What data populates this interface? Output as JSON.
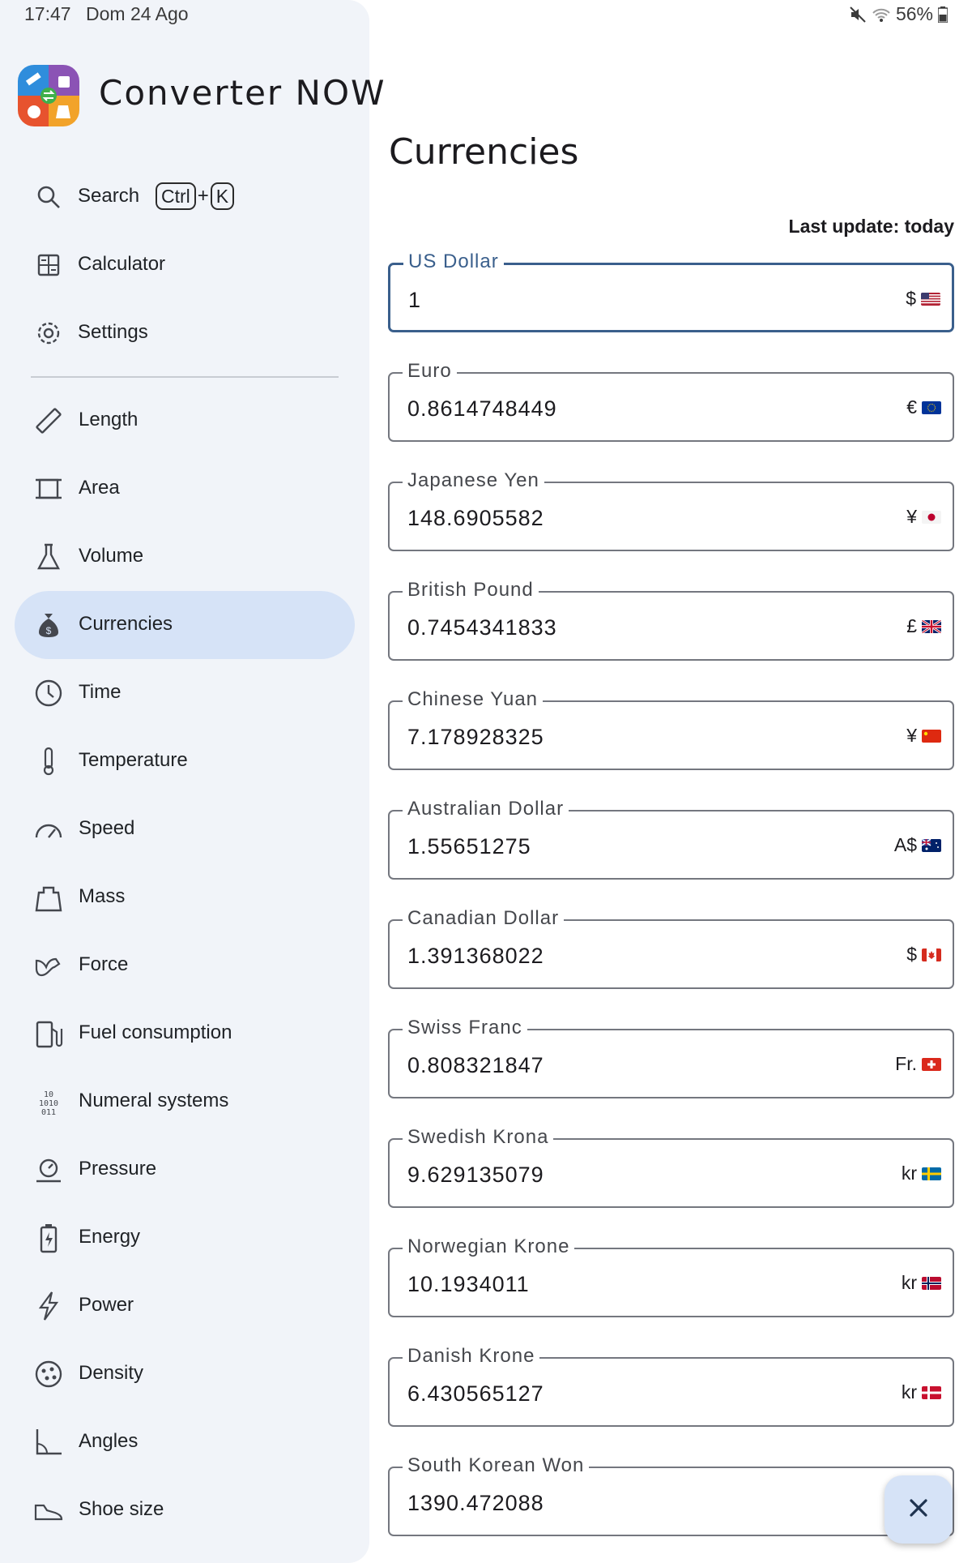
{
  "status_bar": {
    "time": "17:47",
    "date": "Dom 24 Ago",
    "battery": "56%",
    "icons": [
      "mute-icon",
      "wifi-icon",
      "battery-icon"
    ]
  },
  "app": {
    "name": "Converter NOW",
    "accent_color": "#d6e3f7",
    "primary_color": "#3a5f8c"
  },
  "sidebar": {
    "top_items": [
      {
        "label": "Search",
        "icon": "search-icon",
        "shortcut": [
          "Ctrl",
          "+",
          "K"
        ]
      },
      {
        "label": "Calculator",
        "icon": "calculator-icon"
      },
      {
        "label": "Settings",
        "icon": "gear-icon"
      }
    ],
    "items": [
      {
        "label": "Length",
        "icon": "ruler-icon"
      },
      {
        "label": "Area",
        "icon": "crop-icon"
      },
      {
        "label": "Volume",
        "icon": "flask-icon"
      },
      {
        "label": "Currencies",
        "icon": "money-bag-icon",
        "active": true
      },
      {
        "label": "Time",
        "icon": "clock-icon"
      },
      {
        "label": "Temperature",
        "icon": "thermometer-icon"
      },
      {
        "label": "Speed",
        "icon": "speedometer-icon"
      },
      {
        "label": "Mass",
        "icon": "weight-icon"
      },
      {
        "label": "Force",
        "icon": "arm-icon"
      },
      {
        "label": "Fuel consumption",
        "icon": "fuel-pump-icon"
      },
      {
        "label": "Numeral systems",
        "icon": "binary-icon"
      },
      {
        "label": "Pressure",
        "icon": "gauge-icon"
      },
      {
        "label": "Energy",
        "icon": "battery-charging-icon"
      },
      {
        "label": "Power",
        "icon": "lightning-icon"
      },
      {
        "label": "Density",
        "icon": "density-icon"
      },
      {
        "label": "Angles",
        "icon": "angle-icon"
      },
      {
        "label": "Shoe size",
        "icon": "shoe-icon"
      }
    ]
  },
  "main": {
    "title": "Currencies",
    "last_update": "Last update: today",
    "currencies": [
      {
        "name": "US Dollar",
        "value": "1",
        "symbol": "$",
        "flag": "us-flag-icon",
        "focused": true
      },
      {
        "name": "Euro",
        "value": "0.8614748449",
        "symbol": "€",
        "flag": "eu-flag-icon"
      },
      {
        "name": "Japanese Yen",
        "value": "148.6905582",
        "symbol": "¥",
        "flag": "jp-flag-icon"
      },
      {
        "name": "British Pound",
        "value": "0.7454341833",
        "symbol": "£",
        "flag": "gb-flag-icon"
      },
      {
        "name": "Chinese Yuan",
        "value": "7.178928325",
        "symbol": "¥",
        "flag": "cn-flag-icon"
      },
      {
        "name": "Australian Dollar",
        "value": "1.55651275",
        "symbol": "A$",
        "flag": "au-flag-icon"
      },
      {
        "name": "Canadian Dollar",
        "value": "1.391368022",
        "symbol": "$",
        "flag": "ca-flag-icon"
      },
      {
        "name": "Swiss Franc",
        "value": "0.808321847",
        "symbol": "Fr.",
        "flag": "ch-flag-icon"
      },
      {
        "name": "Swedish Krona",
        "value": "9.629135079",
        "symbol": "kr",
        "flag": "se-flag-icon"
      },
      {
        "name": "Norwegian Krone",
        "value": "10.1934011",
        "symbol": "kr",
        "flag": "no-flag-icon"
      },
      {
        "name": "Danish Krone",
        "value": "6.430565127",
        "symbol": "kr",
        "flag": "dk-flag-icon"
      },
      {
        "name": "South Korean Won",
        "value": "1390.472088",
        "symbol": "",
        "flag": ""
      }
    ]
  },
  "fab": {
    "icon": "close-icon"
  }
}
